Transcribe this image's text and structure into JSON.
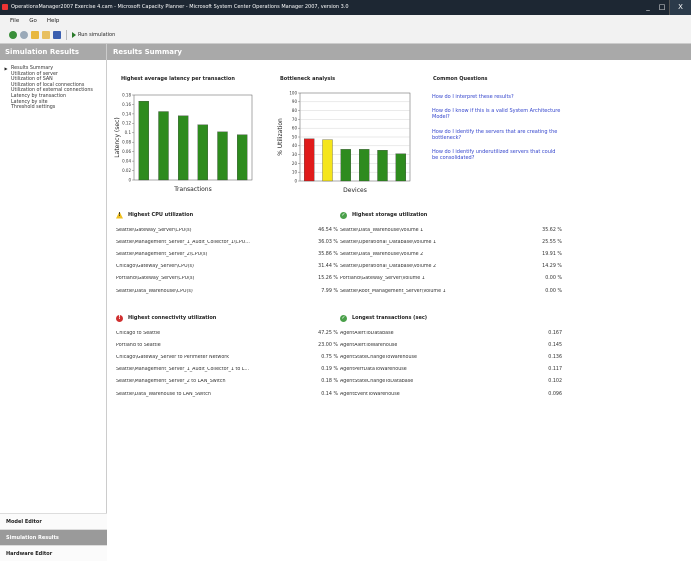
{
  "window": {
    "title": "OperationsManager2007 Exercise 4.cam - Microsoft Capacity Planner - Microsoft System Center Operations Manager 2007, version 3.0",
    "buttons": [
      "_",
      "□",
      "X"
    ]
  },
  "menu": [
    "File",
    "Go",
    "Help"
  ],
  "toolbar": {
    "run_label": "Run simulation"
  },
  "sidebar": {
    "header": "Simulation Results",
    "items": [
      "Results Summary",
      "Utilization of server",
      "Utilization of SAN",
      "Utilization of local connections",
      "Utilization of external connections",
      "Latency by transaction",
      "Latency by site",
      "Threshold settings"
    ],
    "nav": [
      "Model Editor",
      "Simulation Results",
      "Hardware Editor"
    ]
  },
  "main": {
    "header": "Results Summary"
  },
  "sections": {
    "latency_title": "Highest average latency per transaction",
    "bottleneck_title": "Bottleneck analysis",
    "questions_title": "Common Questions"
  },
  "questions": [
    "How do I interpret these results?",
    "How do I know if this is a valid System Architecture Model?",
    "How do I identify the servers that are creating the bottleneck?",
    "How do I identify underutilized servers that could be consolidated?"
  ],
  "chart_data": [
    {
      "type": "bar",
      "title": "Highest average latency per transaction",
      "xlabel": "Transactions",
      "ylabel": "Latency (sec)",
      "ylim": [
        0,
        0.18
      ],
      "yticks": [
        "0",
        "0.02",
        "0.04",
        "0.06",
        "0.08",
        "0.1",
        "0.12",
        "0.14",
        "0.16",
        "0.18"
      ],
      "values": [
        0.167,
        0.145,
        0.136,
        0.117,
        0.102,
        0.096
      ],
      "colors": [
        "#2e8b1e",
        "#2e8b1e",
        "#2e8b1e",
        "#2e8b1e",
        "#2e8b1e",
        "#2e8b1e"
      ],
      "grid": false
    },
    {
      "type": "bar",
      "title": "Bottleneck analysis",
      "xlabel": "Devices",
      "ylabel": "% Utilization",
      "ylim": [
        0,
        100
      ],
      "yticks": [
        "0",
        "10",
        "20",
        "30",
        "40",
        "50",
        "60",
        "70",
        "80",
        "90",
        "100"
      ],
      "values": [
        48,
        47,
        36,
        36,
        35,
        31
      ],
      "colors": [
        "#e01b1b",
        "#f5e51b",
        "#2e8b1e",
        "#2e8b1e",
        "#2e8b1e",
        "#2e8b1e"
      ],
      "grid": true
    }
  ],
  "cpu": {
    "title": "Highest CPU utilization",
    "rows": [
      {
        "name": "Seattle\\Gateway_Server\\CPU(s)",
        "value": "46.54 %"
      },
      {
        "name": "Seattle\\Management_Server_1_Audit_Collector_1\\CPU...",
        "value": "36.03 %"
      },
      {
        "name": "Seattle\\Management_Server_2\\CPU(s)",
        "value": "35.86 %"
      },
      {
        "name": "Chicago\\Gateway_Server\\CPU(s)",
        "value": "31.44 %"
      },
      {
        "name": "Portland\\Gateway_Server\\CPU(s)",
        "value": "15.26 %"
      },
      {
        "name": "Seattle\\Data_Warehouse\\CPU(s)",
        "value": "7.99 %"
      }
    ]
  },
  "storage": {
    "title": "Highest storage utilization",
    "rows": [
      {
        "name": "Seattle\\Data_Warehouse\\Volume 1",
        "value": "35.62 %"
      },
      {
        "name": "Seattle\\Operational_Database\\Volume 1",
        "value": "25.55 %"
      },
      {
        "name": "Seattle\\Data_Warehouse\\Volume 2",
        "value": "19.91 %"
      },
      {
        "name": "Seattle\\Operational_Database\\Volume 2",
        "value": "14.29 %"
      },
      {
        "name": "Portland\\Gateway_Server\\Volume 1",
        "value": "0.00 %"
      },
      {
        "name": "Seattle\\Root_Management_Server\\Volume 1",
        "value": "0.00 %"
      }
    ]
  },
  "connectivity": {
    "title": "Highest connectivity utilization",
    "rows": [
      {
        "name": "Chicago to Seattle",
        "value": "47.25 %"
      },
      {
        "name": "Portland to Seattle",
        "value": "23.00 %"
      },
      {
        "name": "Chicago\\Gateway_Server to Perimeter Network",
        "value": "0.75 %"
      },
      {
        "name": "Seattle\\Management_Server_1_Audit_Collector_1 to L...",
        "value": "0.19 %"
      },
      {
        "name": "Seattle\\Management_Server_2 to LAN_Switch",
        "value": "0.18 %"
      },
      {
        "name": "Seattle\\Data_Warehouse to LAN_Switch",
        "value": "0.14 %"
      }
    ]
  },
  "transactions": {
    "title": "Longest transactions (sec)",
    "rows": [
      {
        "name": "AgentAlertToDatabase",
        "value": "0.167"
      },
      {
        "name": "AgentAlertToWarehouse",
        "value": "0.145"
      },
      {
        "name": "AgentStateChangeToWarehouse",
        "value": "0.136"
      },
      {
        "name": "AgentPerfDataToWarehouse",
        "value": "0.117"
      },
      {
        "name": "AgentStateChangeToDatabase",
        "value": "0.102"
      },
      {
        "name": "AgentEventToWarehouse",
        "value": "0.096"
      }
    ]
  }
}
